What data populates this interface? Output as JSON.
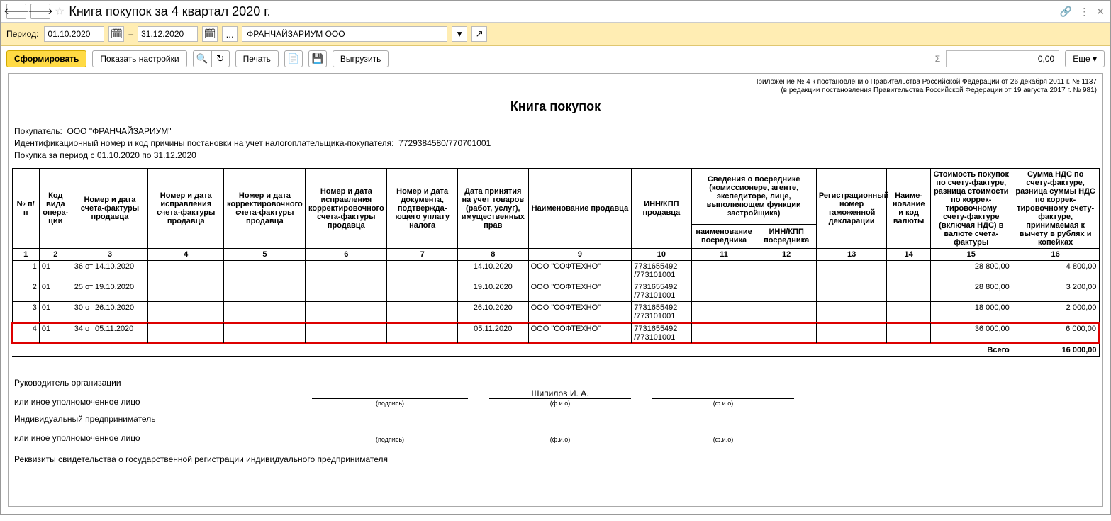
{
  "title": "Книга покупок за 4 квартал 2020 г.",
  "period": {
    "label": "Период:",
    "from": "01.10.2020",
    "dash": "–",
    "to": "31.12.2020"
  },
  "org": "ФРАНЧАЙЗАРИУМ ООО",
  "actions": {
    "form": "Сформировать",
    "show_settings": "Показать настройки",
    "print": "Печать",
    "upload": "Выгрузить",
    "more": "Еще"
  },
  "sum_value": "0,00",
  "legal1": "Приложение № 4 к постановлению Правительства Российской Федерации от 26 декабря 2011 г. № 1137",
  "legal2": "(в редакции постановления Правительства Российской Федерации от 19 августа 2017 г. № 981)",
  "report_title": "Книга покупок",
  "meta": {
    "buyer_label": "Покупатель:",
    "buyer": "ООО \"ФРАНЧАЙЗАРИУМ\"",
    "inn_label": "Идентификационный номер и код причины постановки на учет налогоплательщика-покупателя:",
    "inn": "7729384580/770701001",
    "period_text": "Покупка за период с 01.10.2020 по 31.12.2020"
  },
  "headers": {
    "h1": "№ п/п",
    "h2": "Код вида опера­ции",
    "h3": "Номер и дата счета-фактуры продавца",
    "h4": "Номер и дата исправления счета-фактуры продавца",
    "h5": "Номер и дата корректировоч­ного счета-фактуры продавца",
    "h6": "Номер и дата исправления корректировоч­ного счета-фактуры продавца",
    "h7": "Номер и дата документа, подтвержда­ющего уплату налога",
    "h8": "Дата принятия на учет товаров (работ, услуг), имущес­твенных прав",
    "h9": "Наименование продавца",
    "h10": "ИНН/КПП продавца",
    "hMid": "Сведения о посреднике (комиссионере, агенте, экспедиторе, лице, выполняющем функции застройщика)",
    "h11": "наименование посредника",
    "h12": "ИНН/КПП посредника",
    "h13": "Регистрационный номер таможенной декларации",
    "h14": "Наиме­нование и код валюты",
    "h15": "Стоимость покупок по счету-фактуре, разница стои­мости по коррек­тировочному счету-фактуре (включая НДС) в валюте счета-фактуры",
    "h16": "Сумма НДС по счету-фактуре, разница суммы НДС по коррек­тировочному счету-фактуре, принимаемая к вычету в рублях и копейках"
  },
  "colnums": [
    "1",
    "2",
    "3",
    "4",
    "5",
    "6",
    "7",
    "8",
    "9",
    "10",
    "11",
    "12",
    "13",
    "14",
    "15",
    "16"
  ],
  "rows": [
    {
      "n": "1",
      "op": "01",
      "inv": "36 от 14.10.2020",
      "date": "14.10.2020",
      "seller": "ООО \"СОФТЕХНО\"",
      "inn": "7731655492 /773101001",
      "cost": "28 800,00",
      "vat": "4 800,00"
    },
    {
      "n": "2",
      "op": "01",
      "inv": "25 от 19.10.2020",
      "date": "19.10.2020",
      "seller": "ООО \"СОФТЕХНО\"",
      "inn": "7731655492 /773101001",
      "cost": "28 800,00",
      "vat": "3 200,00"
    },
    {
      "n": "3",
      "op": "01",
      "inv": "30 от 26.10.2020",
      "date": "26.10.2020",
      "seller": "ООО \"СОФТЕХНО\"",
      "inn": "7731655492 /773101001",
      "cost": "18 000,00",
      "vat": "2 000,00"
    },
    {
      "n": "4",
      "op": "01",
      "inv": "34 от 05.11.2020",
      "date": "05.11.2020",
      "seller": "ООО \"СОФТЕХНО\"",
      "inn": "7731655492 /773101001",
      "cost": "36 000,00",
      "vat": "6 000,00",
      "hl": true
    }
  ],
  "total_label": "Всего",
  "total_value": "16 000,00",
  "signatures": {
    "head1": "Руководитель организации",
    "head2": "или иное уполномоченное лицо",
    "name": "Шипилов И. А.",
    "sub_sign": "(подпись)",
    "sub_fio": "(ф.и.о)",
    "ip1": "Индивидуальный предприниматель",
    "ip2": "или иное уполномоченное лицо",
    "rek": "Реквизиты свидетельства о государственной регистрации индивидуального предпринимателя"
  }
}
